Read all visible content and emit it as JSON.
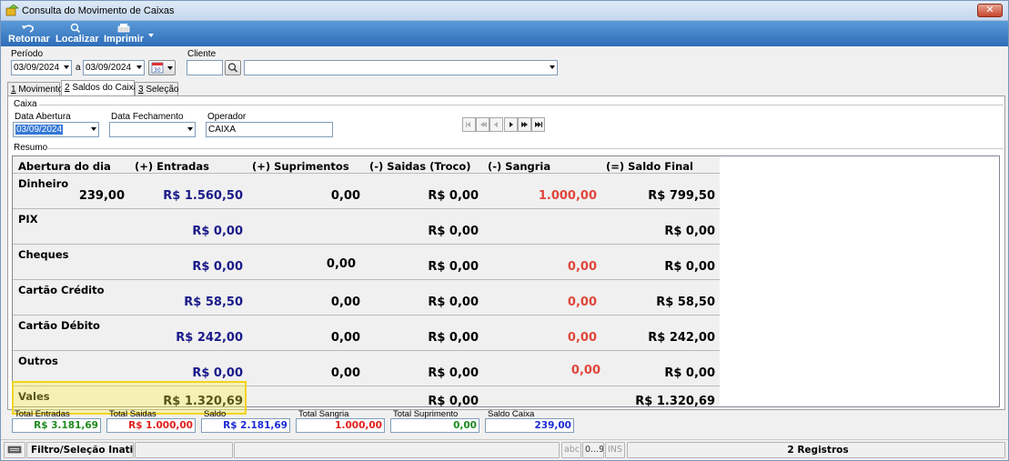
{
  "window": {
    "title": "Consulta do Movimento de Caixas",
    "close_label": "✕"
  },
  "toolbar": {
    "retornar": "Retornar",
    "localizar": "Localizar",
    "imprimir": "Imprimir"
  },
  "filters": {
    "periodo_label": "Período",
    "date_from": "03/09/2024",
    "a_label": "a",
    "date_to": "03/09/2024",
    "cliente_label": "Cliente",
    "cliente_code": "",
    "cliente_name": ""
  },
  "tabs": [
    {
      "num": "1",
      "label": " Movimento"
    },
    {
      "num": "2",
      "label": " Saldos do Caixa"
    },
    {
      "num": "3",
      "label": " Seleção"
    }
  ],
  "caixa": {
    "group_label": "Caixa",
    "data_abertura_label": "Data Abertura",
    "data_abertura_value": "03/09/2024",
    "data_fechamento_label": "Data Fechamento",
    "data_fechamento_value": "",
    "operador_label": "Operador",
    "operador_value": "CAIXA"
  },
  "resumo": {
    "group_label": "Resumo",
    "headers": [
      "Abertura do dia",
      "(+) Entradas",
      "(+) Suprimentos",
      "(-) Saidas (Troco)",
      "(-) Sangria",
      "(=) Saldo Final"
    ],
    "rows": [
      {
        "label": "Dinheiro",
        "abertura": "239,00",
        "entradas": "R$ 1.560,50",
        "suprimentos": "0,00",
        "saidas": "R$ 0,00",
        "sangria": "1.000,00",
        "saldo": "R$ 799,50"
      },
      {
        "label": "PIX",
        "abertura": "",
        "entradas": "R$ 0,00",
        "suprimentos": "",
        "saidas": "R$ 0,00",
        "sangria": "",
        "saldo": "R$ 0,00"
      },
      {
        "label": "Cheques",
        "abertura": "",
        "entradas": "R$ 0,00",
        "suprimentos": "0,00",
        "saidas": "R$ 0,00",
        "sangria": "0,00",
        "saldo": "R$ 0,00"
      },
      {
        "label": "Cartão Crédito",
        "abertura": "",
        "entradas": "R$ 58,50",
        "suprimentos": "0,00",
        "saidas": "R$ 0,00",
        "sangria": "0,00",
        "saldo": "R$ 58,50"
      },
      {
        "label": "Cartão Débito",
        "abertura": "",
        "entradas": "R$ 242,00",
        "suprimentos": "0,00",
        "saidas": "R$ 0,00",
        "sangria": "0,00",
        "saldo": "R$ 242,00"
      },
      {
        "label": "Outros",
        "abertura": "",
        "entradas": "R$ 0,00",
        "suprimentos": "0,00",
        "saidas": "R$ 0,00",
        "sangria": "0,00",
        "saldo": "R$ 0,00"
      },
      {
        "label": "Vales",
        "abertura": "",
        "entradas": "R$ 1.320,69",
        "suprimentos": "",
        "saidas": "R$ 0,00",
        "sangria": "",
        "saldo": "R$ 1.320,69"
      }
    ]
  },
  "totals": [
    {
      "label": "Total Entradas",
      "value": "R$ 3.181,69",
      "color": "#1e8a1e"
    },
    {
      "label": "Total Saidas",
      "value": "R$ 1.000,00",
      "color": "#e0201c"
    },
    {
      "label": "Saldo",
      "value": "R$ 2.181,69",
      "color": "#1c2bd6"
    },
    {
      "label": "Total Sangria",
      "value": "1.000,00",
      "color": "#e0201c"
    },
    {
      "label": "Total Suprimento",
      "value": "0,00",
      "color": "#1e8a1e"
    },
    {
      "label": "Saldo Caixa",
      "value": "239,00",
      "color": "#1c2bd6"
    }
  ],
  "status": {
    "filtro": "Filtro/Seleção Inativo(s)",
    "abc": "abc",
    "digits": "0...9",
    "ins": "INS",
    "registros": "2 Registros"
  },
  "colors": {
    "toolbar": "#2d6db8",
    "highlight": "#f1d31d",
    "blue_value": "#1a1a8a",
    "red_value": "#e0463c"
  }
}
